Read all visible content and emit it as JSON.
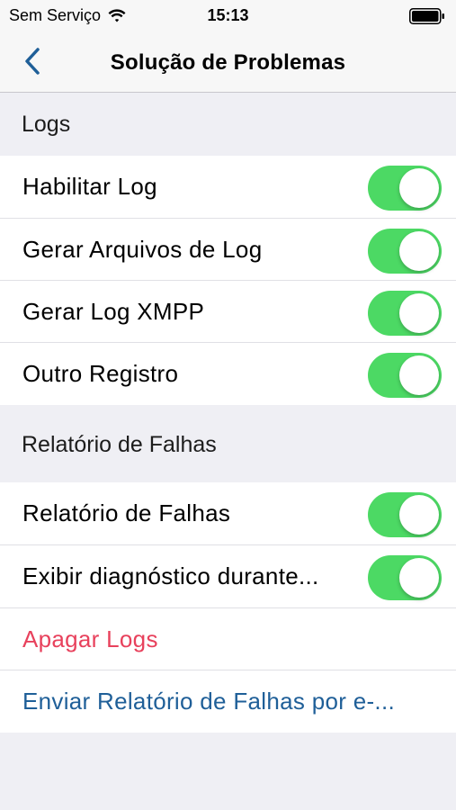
{
  "status_bar": {
    "carrier": "Sem Serviço",
    "time": "15:13"
  },
  "nav": {
    "title": "Solução de Problemas",
    "back_icon": "chevron-left-icon"
  },
  "sections": [
    {
      "header": "Logs",
      "rows": [
        {
          "label": "Habilitar Log",
          "toggle": true
        },
        {
          "label": "Gerar Arquivos de Log",
          "toggle": true
        },
        {
          "label": "Gerar Log XMPP",
          "toggle": true
        },
        {
          "label": "Outro Registro",
          "toggle": true
        }
      ]
    },
    {
      "header": "Relatório de Falhas",
      "rows": [
        {
          "label": "Relatório de Falhas",
          "toggle": true
        },
        {
          "label": "Exibir diagnóstico durante...",
          "toggle": true
        }
      ]
    }
  ],
  "actions": {
    "clear_logs": "Apagar Logs",
    "send_report": "Enviar Relatório de Falhas por e-..."
  },
  "colors": {
    "toggle_on": "#4cd964",
    "destructive": "#e8415c",
    "link": "#1f5f98",
    "back_chevron": "#1f5f98"
  }
}
